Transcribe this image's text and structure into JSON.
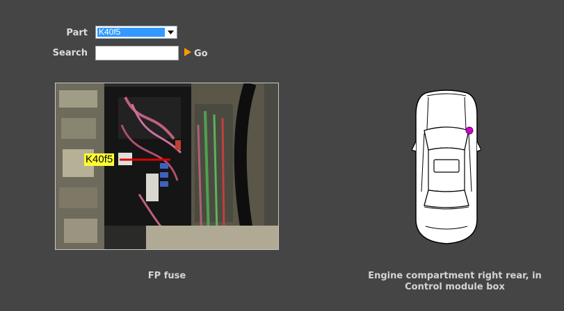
{
  "form": {
    "part_label": "Part",
    "part_selected": "K40f5",
    "search_label": "Search",
    "search_value": "",
    "go_label": "Go"
  },
  "photo": {
    "callout_label": "K40f5"
  },
  "captions": {
    "component": "FP fuse",
    "location_line1": "Engine compartment right rear, in",
    "location_line2": "Control module box"
  },
  "colors": {
    "background": "#454545",
    "select_highlight": "#3399ff",
    "go_arrow": "#ff9900",
    "callout_bg": "#ffff33",
    "marker": "#cc00cc"
  },
  "icons": {
    "go": "play-arrow-icon",
    "select": "chevron-down-icon"
  }
}
